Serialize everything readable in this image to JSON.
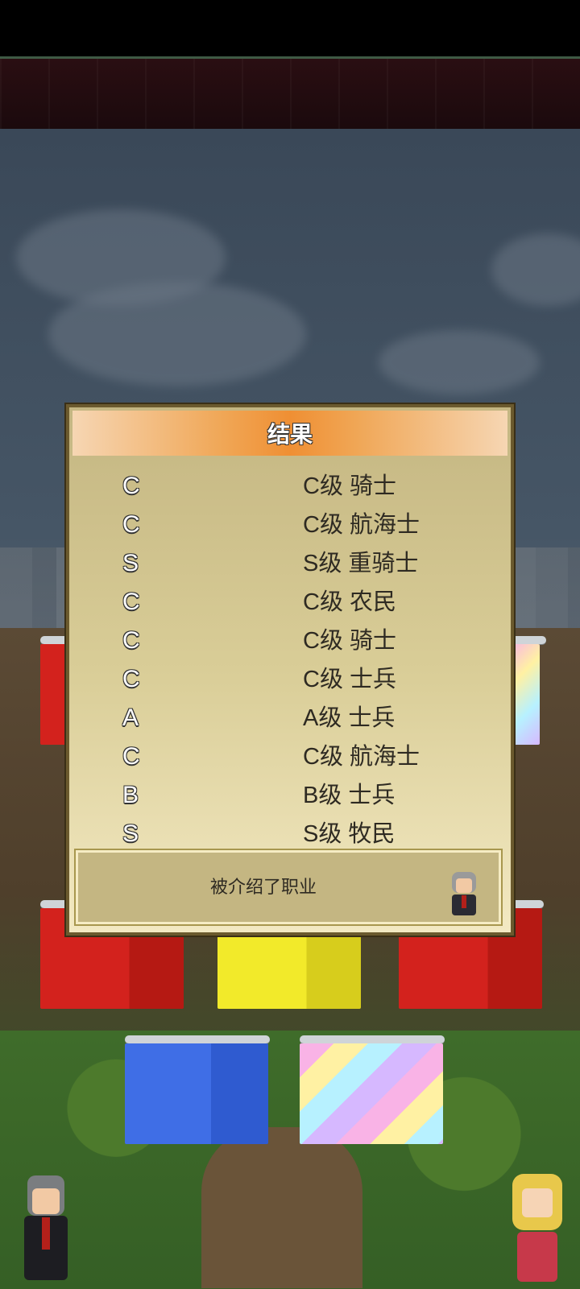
{
  "dialog": {
    "title": "结果",
    "results": [
      {
        "grade": "C",
        "job": "C级 骑士"
      },
      {
        "grade": "C",
        "job": "C级 航海士"
      },
      {
        "grade": "S",
        "job": "S级 重骑士"
      },
      {
        "grade": "C",
        "job": "C级 农民"
      },
      {
        "grade": "C",
        "job": "C级 骑士"
      },
      {
        "grade": "C",
        "job": "C级 士兵"
      },
      {
        "grade": "A",
        "job": "A级 士兵"
      },
      {
        "grade": "C",
        "job": "C级 航海士"
      },
      {
        "grade": "B",
        "job": "B级 士兵"
      },
      {
        "grade": "S",
        "job": "S级 牧民"
      }
    ],
    "message": "被介绍了职业"
  },
  "colors": {
    "title_bar": "#ef8f33",
    "panel": "#d9cd97",
    "curtain_red": "#d3221d",
    "curtain_yellow": "#f2ea2a",
    "curtain_blue": "#3f6ee6"
  },
  "icons": [
    "advisor-portrait-icon",
    "left-character-icon",
    "right-character-icon"
  ]
}
